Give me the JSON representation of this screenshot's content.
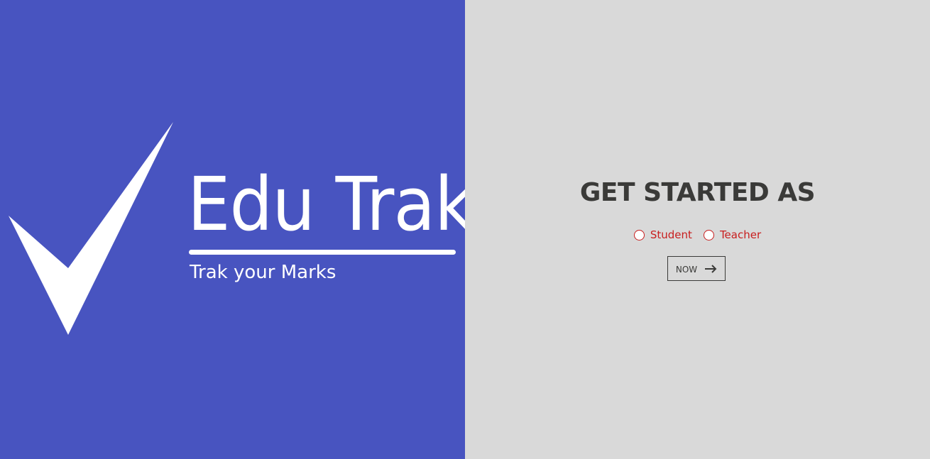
{
  "brand": {
    "title": "Edu Trak",
    "tagline": "Trak your Marks",
    "logo_icon": "check-mark-icon"
  },
  "get_started": {
    "heading": "GET STARTED AS",
    "roles": [
      {
        "label": "Student",
        "selected": false
      },
      {
        "label": "Teacher",
        "selected": false
      }
    ],
    "button_label": "NOW",
    "button_icon": "arrow-right-icon"
  },
  "colors": {
    "left_panel_bg": "#4854c0",
    "right_panel_bg": "#d9d9d9",
    "heading_text": "#3a3a38",
    "role_text": "#c81e1e",
    "brand_text": "#ffffff"
  }
}
